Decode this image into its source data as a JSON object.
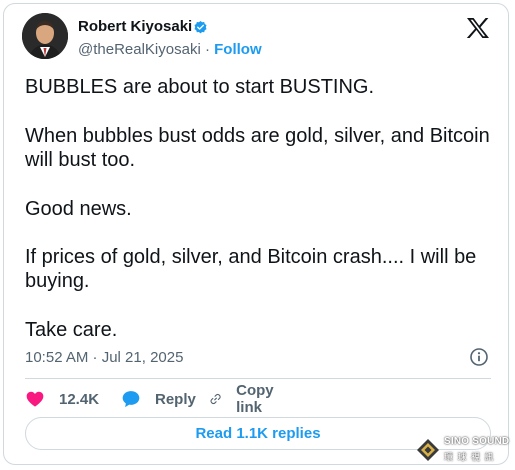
{
  "author": {
    "name": "Robert Kiyosaki",
    "handle": "@theRealKiyosaki",
    "separator": "·",
    "follow_label": "Follow"
  },
  "tweet": {
    "paragraphs": [
      "BUBBLES are about to start BUSTING.",
      "When bubbles bust odds are gold, silver, and Bitcoin will bust too.",
      "Good news.",
      "If prices of gold, silver, and Bitcoin crash.... I will be buying.",
      "Take care."
    ],
    "timestamp": "10:52 AM · Jul 21, 2025"
  },
  "actions": {
    "like_count": "12.4K",
    "reply_label": "Reply",
    "copy_label": "Copy link"
  },
  "read_replies_label": "Read 1.1K replies",
  "watermark": {
    "top": "SINO SOUND",
    "bottom": "環 球 視 訊"
  },
  "icons": {
    "platform": "x-logo-icon",
    "verified": "verified-badge-icon",
    "info": "info-icon",
    "like": "heart-icon",
    "reply": "speech-bubble-icon",
    "copy": "link-icon"
  },
  "colors": {
    "accent": "#1d9bf0",
    "like": "#f91880",
    "text": "#0f1419",
    "muted": "#536471",
    "border": "#cfd9de"
  }
}
